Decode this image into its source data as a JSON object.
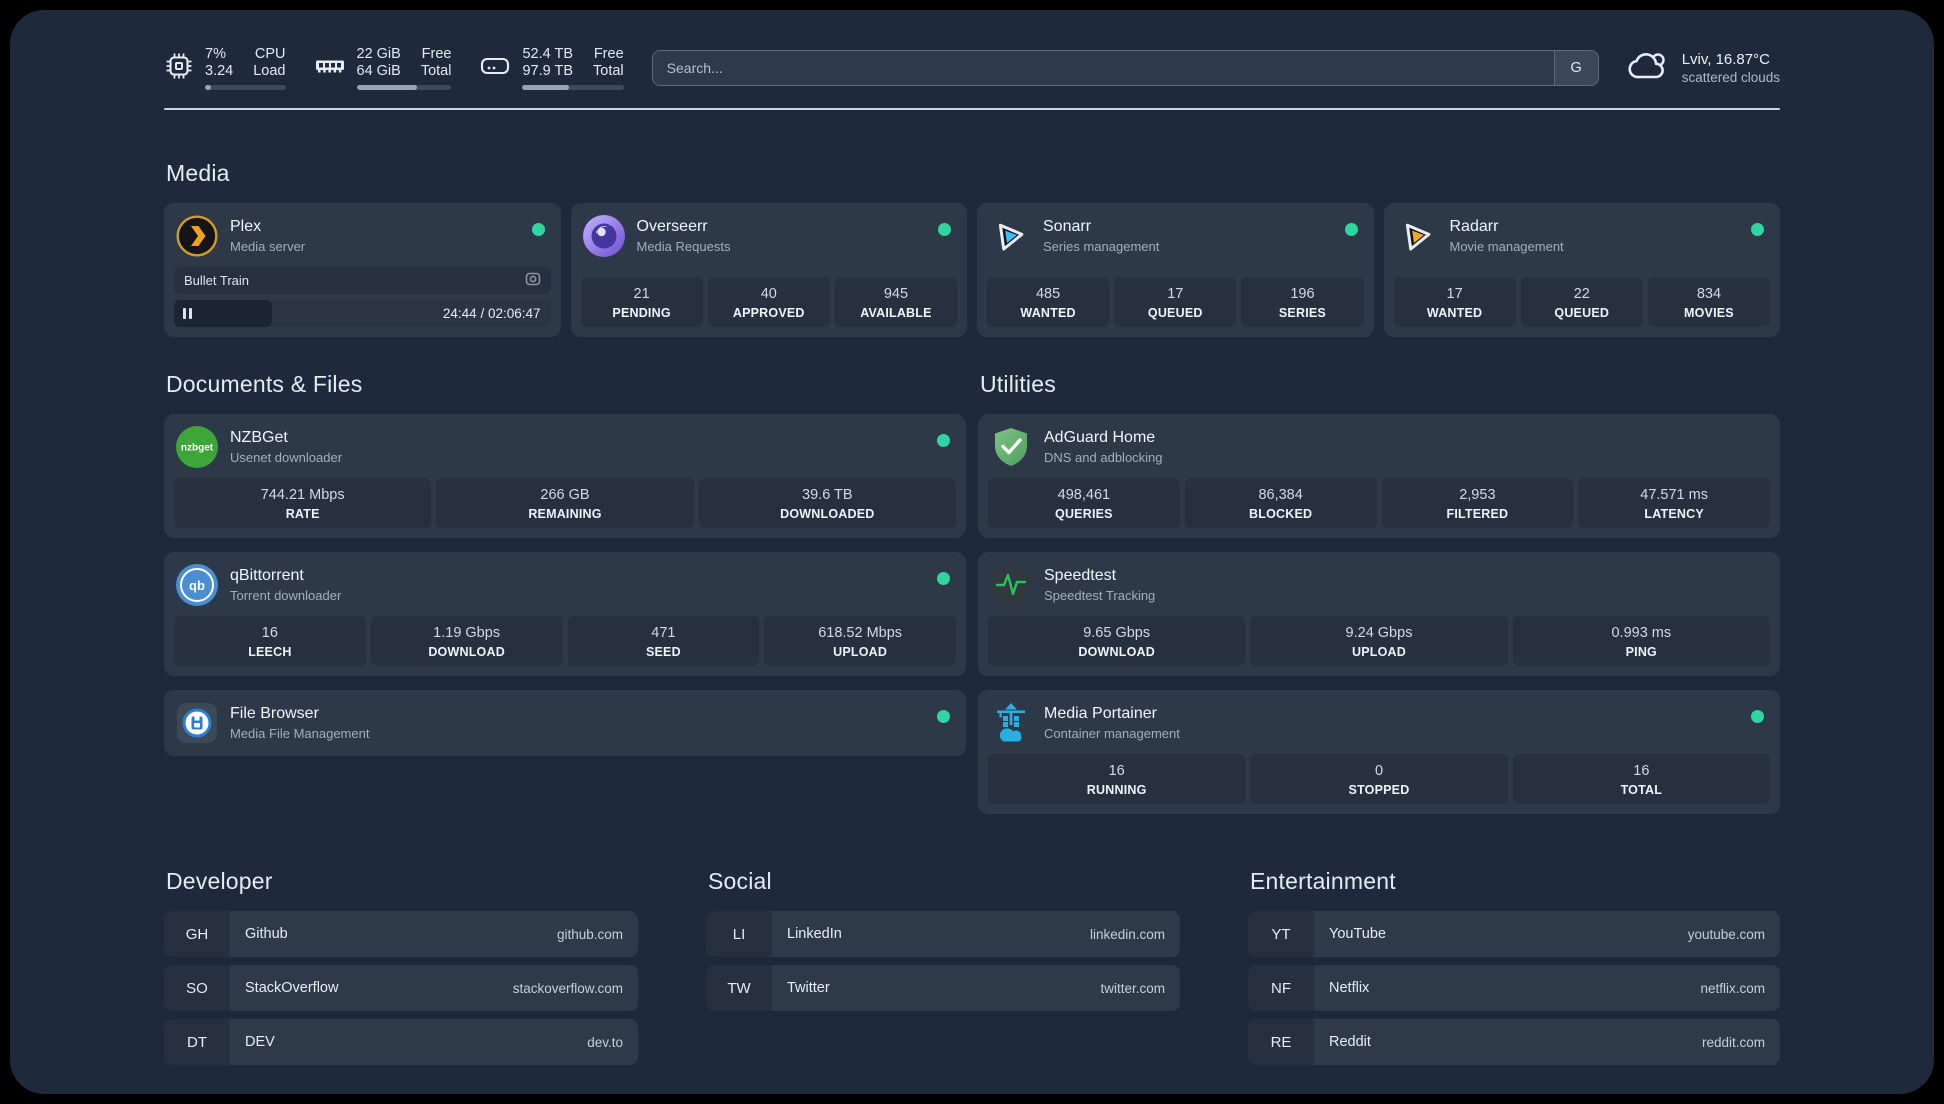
{
  "app": {
    "search_placeholder": "Search...",
    "search_engine": "G"
  },
  "colors": {
    "status_online": "#2fd6a0",
    "panel_background": "#1e293b",
    "card_background": "#2d3949",
    "plex_amber": "#f0a11d",
    "sonarr_blue": "#3fbdf0",
    "radarr_amber": "#f7a723",
    "nzbget_green": "#3da639",
    "adguard_green": "#5fb36a",
    "qbittorrent_blue": "#4a8fd3",
    "speedtest_green": "#22c55e",
    "portainer_blue": "#29b0e0"
  },
  "header": {
    "stats": [
      {
        "value1": "7%",
        "label1": "CPU",
        "value2": "3.24",
        "label2": "Load",
        "progress": 8
      },
      {
        "value1": "22 GiB",
        "label1": "Free",
        "value2": "64 GiB",
        "label2": "Total",
        "progress": 64
      },
      {
        "value1": "52.4 TB",
        "label1": "Free",
        "value2": "97.9 TB",
        "label2": "Total",
        "progress": 46
      }
    ],
    "weather": {
      "title": "Lviv, 16.87°C",
      "subtitle": "scattered clouds"
    }
  },
  "sections": {
    "media": {
      "title": "Media",
      "services": [
        {
          "name": "Plex",
          "desc": "Media server",
          "status": "online",
          "widget": {
            "now_playing": "Bullet Train",
            "time": "24:44 / 02:06:47",
            "progress": 26
          }
        },
        {
          "name": "Overseerr",
          "desc": "Media Requests",
          "status": "online",
          "stats": [
            {
              "value": "21",
              "label": "PENDING"
            },
            {
              "value": "40",
              "label": "APPROVED"
            },
            {
              "value": "945",
              "label": "AVAILABLE"
            }
          ]
        },
        {
          "name": "Sonarr",
          "desc": "Series management",
          "status": "online",
          "stats": [
            {
              "value": "485",
              "label": "WANTED"
            },
            {
              "value": "17",
              "label": "QUEUED"
            },
            {
              "value": "196",
              "label": "SERIES"
            }
          ]
        },
        {
          "name": "Radarr",
          "desc": "Movie management",
          "status": "online",
          "stats": [
            {
              "value": "17",
              "label": "WANTED"
            },
            {
              "value": "22",
              "label": "QUEUED"
            },
            {
              "value": "834",
              "label": "MOVIES"
            }
          ]
        }
      ]
    },
    "documents": {
      "title": "Documents & Files",
      "services": [
        {
          "name": "NZBGet",
          "desc": "Usenet downloader",
          "status": "online",
          "stats": [
            {
              "value": "744.21 Mbps",
              "label": "RATE"
            },
            {
              "value": "266 GB",
              "label": "REMAINING"
            },
            {
              "value": "39.6 TB",
              "label": "DOWNLOADED"
            }
          ]
        },
        {
          "name": "qBittorrent",
          "desc": "Torrent downloader",
          "status": "online",
          "stats": [
            {
              "value": "16",
              "label": "LEECH"
            },
            {
              "value": "1.19 Gbps",
              "label": "DOWNLOAD"
            },
            {
              "value": "471",
              "label": "SEED"
            },
            {
              "value": "618.52 Mbps",
              "label": "UPLOAD"
            }
          ]
        },
        {
          "name": "File Browser",
          "desc": "Media File Management",
          "status": "online",
          "stats": []
        }
      ]
    },
    "utilities": {
      "title": "Utilities",
      "services": [
        {
          "name": "AdGuard Home",
          "desc": "DNS and adblocking",
          "stats": [
            {
              "value": "498,461",
              "label": "QUERIES"
            },
            {
              "value": "86,384",
              "label": "BLOCKED"
            },
            {
              "value": "2,953",
              "label": "FILTERED"
            },
            {
              "value": "47.571 ms",
              "label": "LATENCY"
            }
          ]
        },
        {
          "name": "Speedtest",
          "desc": "Speedtest Tracking",
          "stats": [
            {
              "value": "9.65 Gbps",
              "label": "DOWNLOAD"
            },
            {
              "value": "9.24 Gbps",
              "label": "UPLOAD"
            },
            {
              "value": "0.993 ms",
              "label": "PING"
            }
          ]
        },
        {
          "name": "Media Portainer",
          "desc": "Container management",
          "status": "online",
          "stats": [
            {
              "value": "16",
              "label": "RUNNING"
            },
            {
              "value": "0",
              "label": "STOPPED"
            },
            {
              "value": "16",
              "label": "TOTAL"
            }
          ]
        }
      ]
    },
    "developer": {
      "title": "Developer",
      "links": [
        {
          "abbr": "GH",
          "name": "Github",
          "domain": "github.com"
        },
        {
          "abbr": "SO",
          "name": "StackOverflow",
          "domain": "stackoverflow.com"
        },
        {
          "abbr": "DT",
          "name": "DEV",
          "domain": "dev.to"
        }
      ]
    },
    "social": {
      "title": "Social",
      "links": [
        {
          "abbr": "LI",
          "name": "LinkedIn",
          "domain": "linkedin.com"
        },
        {
          "abbr": "TW",
          "name": "Twitter",
          "domain": "twitter.com"
        }
      ]
    },
    "entertainment": {
      "title": "Entertainment",
      "links": [
        {
          "abbr": "YT",
          "name": "YouTube",
          "domain": "youtube.com"
        },
        {
          "abbr": "NF",
          "name": "Netflix",
          "domain": "netflix.com"
        },
        {
          "abbr": "RE",
          "name": "Reddit",
          "domain": "reddit.com"
        }
      ]
    }
  }
}
